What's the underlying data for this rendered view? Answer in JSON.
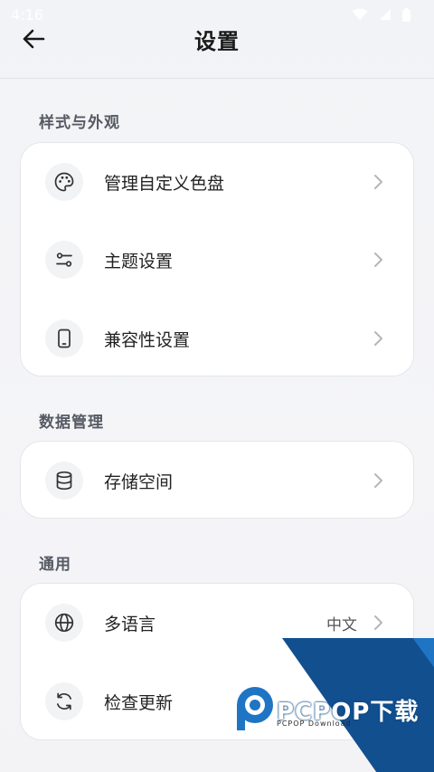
{
  "status": {
    "time": "4:16"
  },
  "header": {
    "title": "设置"
  },
  "sections": [
    {
      "label": "样式与外观",
      "items": [
        {
          "label": "管理自定义色盘",
          "icon": "palette-icon"
        },
        {
          "label": "主题设置",
          "icon": "sliders-icon"
        },
        {
          "label": "兼容性设置",
          "icon": "phone-icon"
        }
      ]
    },
    {
      "label": "数据管理",
      "items": [
        {
          "label": "存储空间",
          "icon": "database-icon"
        }
      ]
    },
    {
      "label": "通用",
      "items": [
        {
          "label": "多语言",
          "value": "中文",
          "icon": "globe-icon"
        },
        {
          "label": "检查更新",
          "icon": "refresh-icon"
        }
      ]
    }
  ],
  "watermark": {
    "brand": "PCPOP下载",
    "sub": "PCPOP Download"
  },
  "colors": {
    "watermark_dark": "#124f8f",
    "watermark_light": "#1f74c4",
    "background": "#f3f4f7"
  }
}
